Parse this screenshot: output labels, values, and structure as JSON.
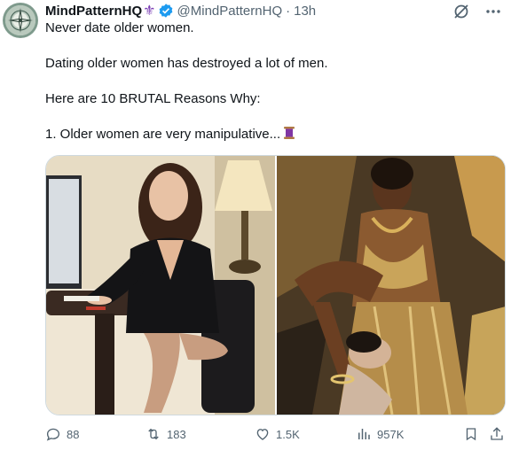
{
  "author": {
    "display_name": "MindPatternHQ",
    "handle": "@MindPatternHQ",
    "separator": "·",
    "time": "13h"
  },
  "tweet": {
    "lines": [
      "Never date older women.",
      "Dating older women has destroyed a lot of men.",
      "Here are 10 BRUTAL Reasons Why:",
      "1. Older women are very manipulative..."
    ]
  },
  "icons": {
    "avatar": "compass-avatar",
    "badge": "fleur-de-lis-icon",
    "verified": "verified-badge-icon",
    "grok": "grok-icon",
    "more": "more-icon",
    "emoji": "thread-spool-emoji",
    "reply": "reply-icon",
    "retweet": "retweet-icon",
    "like": "like-icon",
    "views": "views-icon",
    "bookmark": "bookmark-icon",
    "share": "share-icon"
  },
  "media": {
    "left_image": "woman-office-desk-photo",
    "right_image": "painting-woman-gold-dress"
  },
  "stats": {
    "replies": "88",
    "retweets": "183",
    "likes": "1.5K",
    "views": "957K"
  },
  "colors": {
    "text": "#0f1419",
    "secondary": "#536471",
    "verified_blue": "#1d9bf0",
    "badge_purple": "#7b3fb5"
  }
}
